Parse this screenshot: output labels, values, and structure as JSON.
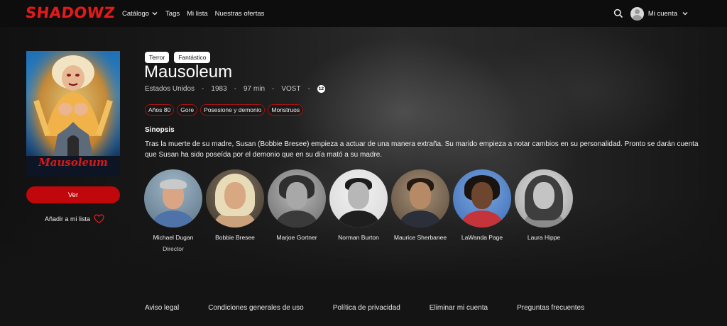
{
  "brand": {
    "logo_text": "SHADOWZ",
    "accent": "#e01b1b",
    "button_red": "#c0080c"
  },
  "nav": {
    "items": [
      {
        "label": "Catálogo",
        "has_dropdown": true
      },
      {
        "label": "Tags"
      },
      {
        "label": "Mi lista"
      },
      {
        "label": "Nuestras ofertas"
      }
    ],
    "search_icon": "search-icon",
    "account_label": "Mi cuenta"
  },
  "movie": {
    "genres": [
      "Terror",
      "Fantástico"
    ],
    "title": "Mausoleum",
    "meta": {
      "country": "Estados Unidos",
      "year": "1983",
      "duration": "97 min",
      "version": "VOST",
      "age_rating": "12"
    },
    "tags": [
      "Años 80",
      "Gore",
      "Posesione y demonio",
      "Monstruos"
    ],
    "synopsis_label": "Sinopsis",
    "synopsis": "Tras la muerte de su madre, Susan (Bobbie Bresee) empieza a actuar de una manera extraña. Su marido empieza a notar cambios en su personalidad. Pronto se darán cuenta que Susan ha sido poseída por el demonio que en su día mató a su madre."
  },
  "poster": {
    "title_art": "Mausoleum"
  },
  "actions": {
    "watch_label": "Ver",
    "add_list_label": "Añadir a mi lista"
  },
  "cast": [
    {
      "name": "Michael Dugan",
      "role": "Director"
    },
    {
      "name": "Bobbie Bresee",
      "role": ""
    },
    {
      "name": "Marjoe Gortner",
      "role": ""
    },
    {
      "name": "Norman Burton",
      "role": ""
    },
    {
      "name": "Maurice Sherbanee",
      "role": ""
    },
    {
      "name": "LaWanda Page",
      "role": ""
    },
    {
      "name": "Laura Hippe",
      "role": ""
    }
  ],
  "footer": {
    "links": [
      "Aviso legal",
      "Condiciones generales de uso",
      "Política de privacidad",
      "Eliminar mi cuenta",
      "Preguntas frecuentes"
    ]
  }
}
